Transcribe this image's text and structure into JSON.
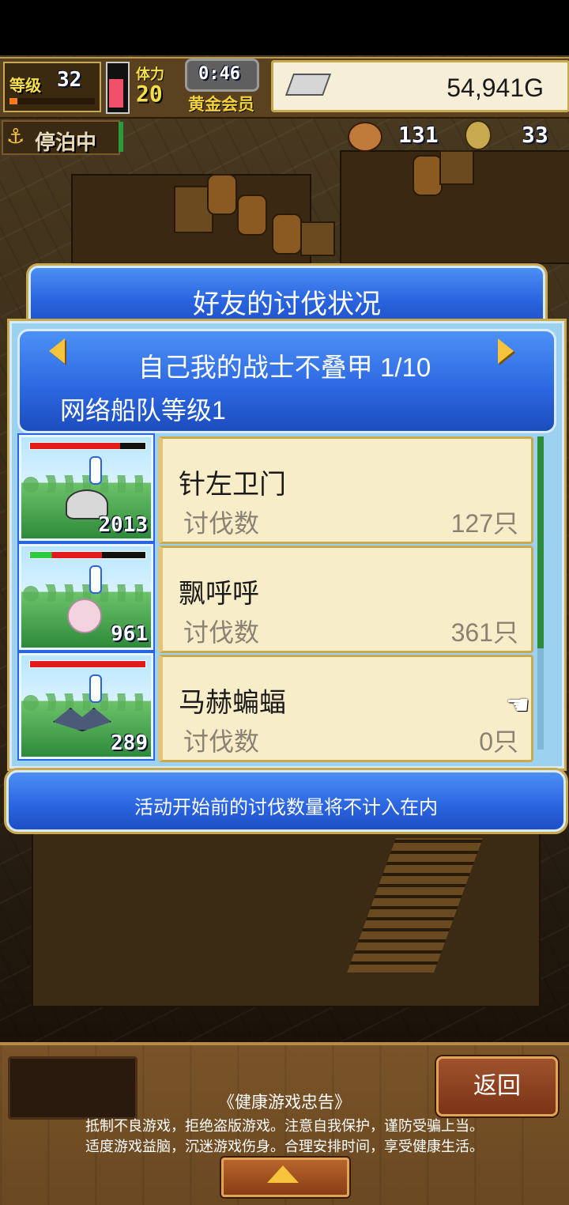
{
  "hud": {
    "level_label": "等级",
    "level_value": "32",
    "stamina_label": "体力",
    "stamina_value": "20",
    "timer": "0:46",
    "membership": "黄金会员",
    "gold": "54,941G"
  },
  "status": {
    "docking": "停泊中",
    "food_count": "131",
    "material_count": "33"
  },
  "panel": {
    "title": "好友的讨伐状况",
    "friend_name": "自己我的战士不叠甲 1/10",
    "fleet_level": "网络船队等级1",
    "rows": [
      {
        "name": "针左卫门",
        "kill_label": "讨伐数",
        "kill_count": "127只",
        "thumb_number": "2013",
        "hp_fraction": 0.78,
        "hp_color": "#e11c1c"
      },
      {
        "name": "飘呼呼",
        "kill_label": "讨伐数",
        "kill_count": "361只",
        "thumb_number": "961",
        "hp_fraction": 0.62,
        "hp_color": "#e11c1c"
      },
      {
        "name": "马赫蝙蝠",
        "kill_label": "讨伐数",
        "kill_count": "0只",
        "thumb_number": "289",
        "hp_fraction": 1.0,
        "hp_color": "#e11c1c"
      }
    ],
    "notice": "活动开始前的讨伐数量将不计入在内"
  },
  "bottom": {
    "back_label": "返回",
    "health_title": "《健康游戏忠告》",
    "health_line1": "抵制不良游戏，拒绝盗版游戏。注意自我保护，谨防受骗上当。",
    "health_line2": "适度游戏益脑，沉迷游戏伤身。合理安排时间，享受健康生活。"
  },
  "colors": {
    "panel_blue": "#2a64e0",
    "card_cream": "#f8edc9",
    "gold_trim": "#c9a94f"
  }
}
